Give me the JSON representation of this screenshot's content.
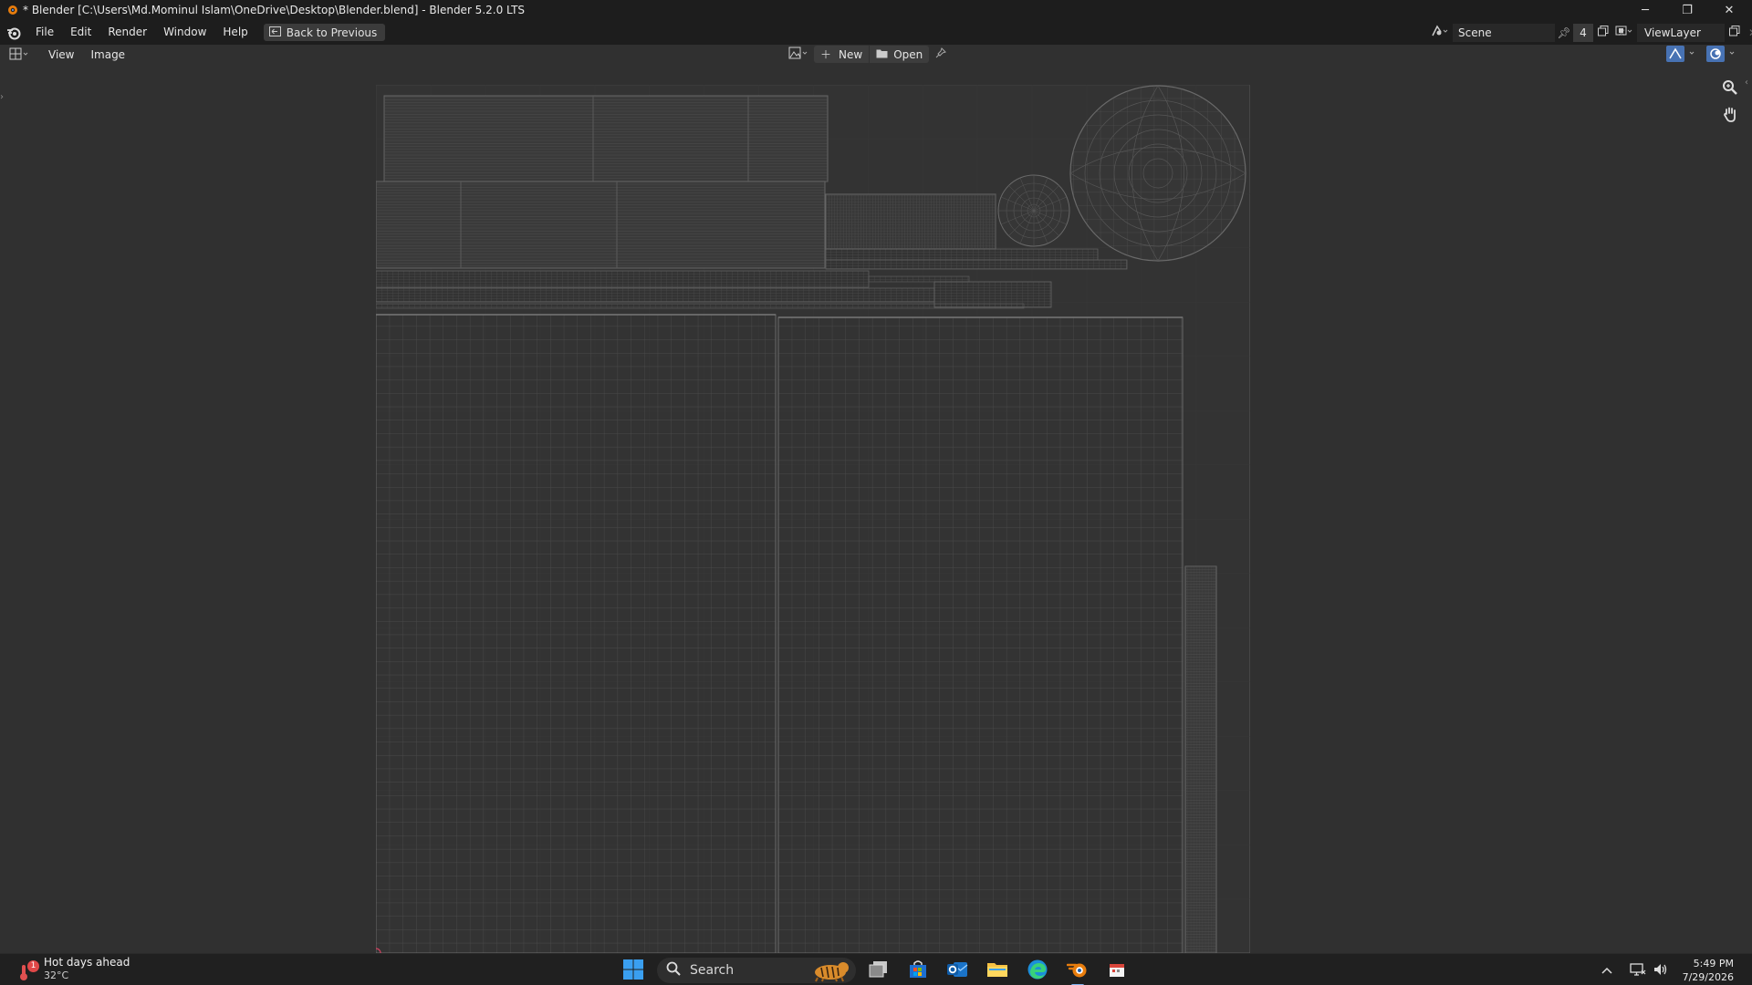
{
  "window": {
    "title": "* Blender [C:\\Users\\Md.Mominul Islam\\OneDrive\\Desktop\\Blender.blend] - Blender 5.2.0 LTS",
    "minimize_glyph": "─",
    "maximize_glyph": "❐",
    "close_glyph": "✕"
  },
  "topbar": {
    "menus": [
      "File",
      "Edit",
      "Render",
      "Window",
      "Help"
    ],
    "back_button": "Back to Previous",
    "scene_name": "Scene",
    "scene_users": "4",
    "view_layer": "ViewLayer"
  },
  "editor_header": {
    "menus": [
      "View",
      "Image"
    ],
    "new_label": "New",
    "open_label": "Open"
  },
  "taskbar": {
    "weather_title": "Hot days ahead",
    "weather_temp": "32°C",
    "weather_badge": "1",
    "search_placeholder": "Search",
    "time": "5:49 PM",
    "date": "7/29/2026"
  },
  "colors": {
    "background": "#303030",
    "topbar": "#1d1d1d",
    "uv_lines": "#5a5a5a",
    "accent": "#4772b3",
    "blender_orange": "#e87d0d"
  }
}
